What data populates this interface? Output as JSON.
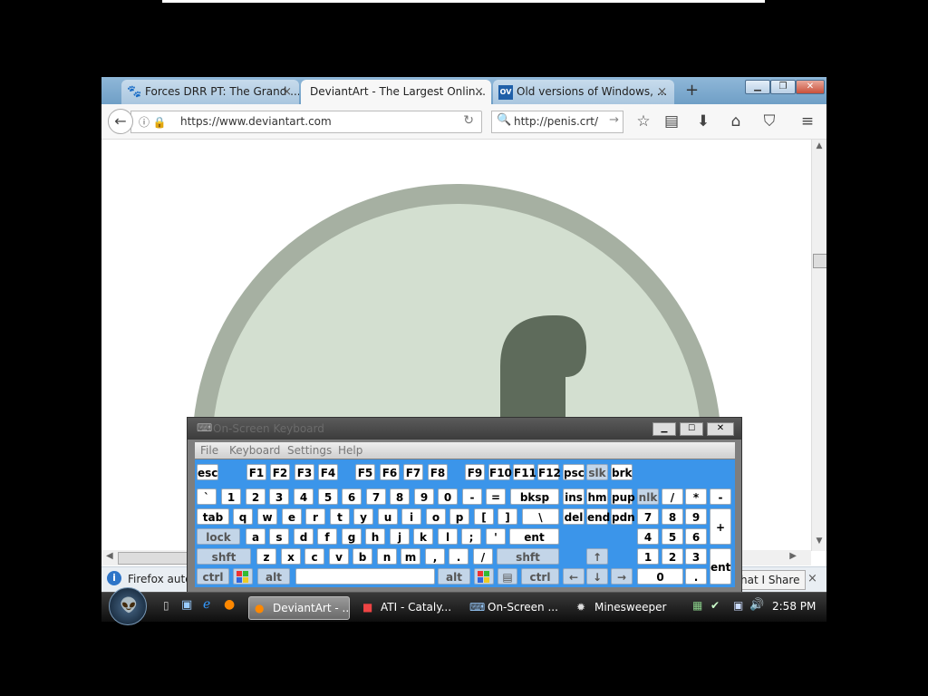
{
  "browser": {
    "tabs": [
      {
        "title": "Forces DRR PT: The Grand ...",
        "icon": "paw-icon",
        "active": false
      },
      {
        "title": "DeviantArt - The Largest Onlin...",
        "icon": "none",
        "active": true
      },
      {
        "title": "Old versions of Windows, ...",
        "icon": "ov-icon",
        "active": false
      }
    ],
    "ov_badge": "OV",
    "new_tab": "+",
    "close_glyph": "×",
    "url": "https://www.deviantart.com",
    "search_value": "http://penis.crt/",
    "notification": "Firefox autom",
    "share_button": "hat I Share"
  },
  "keyboard": {
    "title": "On-Screen Keyboard",
    "menu": [
      "File",
      "Keyboard",
      "Settings",
      "Help"
    ],
    "rows": {
      "fn": [
        "esc",
        "F1",
        "F2",
        "F3",
        "F4",
        "F5",
        "F6",
        "F7",
        "F8",
        "F9",
        "F10",
        "F11",
        "F12",
        "psc",
        "slk",
        "brk"
      ],
      "num": [
        "`",
        "1",
        "2",
        "3",
        "4",
        "5",
        "6",
        "7",
        "8",
        "9",
        "0",
        "-",
        "=",
        "bksp",
        "ins",
        "hm",
        "pup",
        "nlk",
        "/",
        "*",
        "-"
      ],
      "top": [
        "tab",
        "q",
        "w",
        "e",
        "r",
        "t",
        "y",
        "u",
        "i",
        "o",
        "p",
        "[",
        "]",
        "\\",
        "del",
        "end",
        "pdn",
        "7",
        "8",
        "9",
        "+"
      ],
      "home": [
        "lock",
        "a",
        "s",
        "d",
        "f",
        "g",
        "h",
        "j",
        "k",
        "l",
        ";",
        "'",
        "ent",
        "4",
        "5",
        "6"
      ],
      "shift": [
        "shft",
        "z",
        "x",
        "c",
        "v",
        "b",
        "n",
        "m",
        ",",
        ".",
        "/",
        "shft",
        "↑",
        "1",
        "2",
        "3",
        "ent"
      ],
      "bottom": [
        "ctrl",
        "alt",
        "alt",
        "ctrl",
        "←",
        "↓",
        "→",
        "0",
        "."
      ]
    }
  },
  "taskbar": {
    "items": [
      "DeviantArt - ...",
      "ATI - Cataly...",
      "On-Screen ...",
      "Minesweeper"
    ],
    "clock": "2:58 PM"
  }
}
